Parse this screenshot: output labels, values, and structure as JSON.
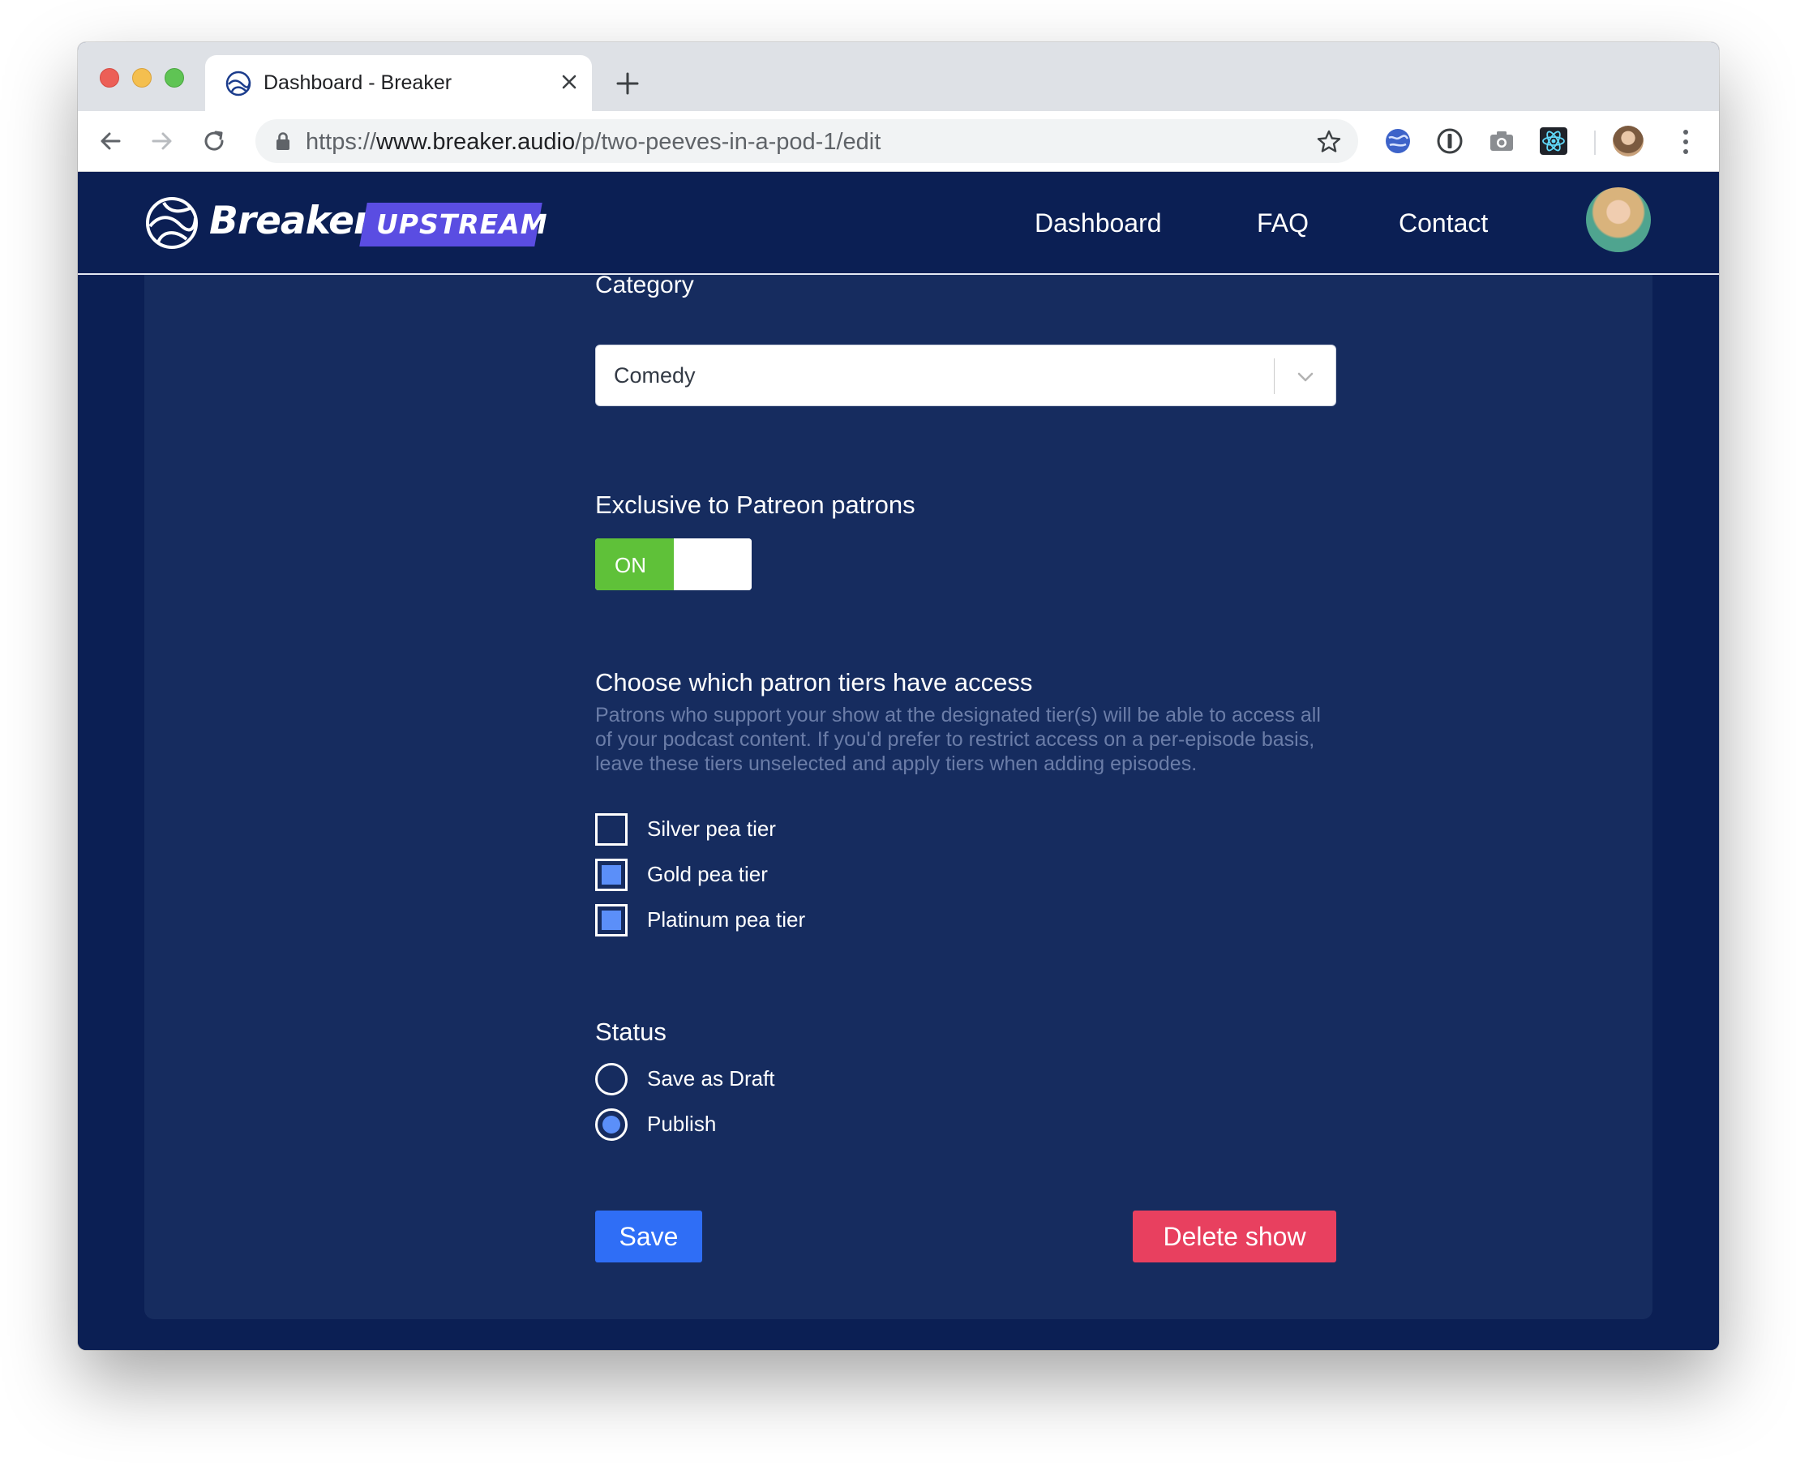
{
  "browser": {
    "tab_title": "Dashboard - Breaker",
    "url_scheme": "https://",
    "url_host": "www.breaker.audio",
    "url_path": "/p/two-peeves-in-a-pod-1/edit"
  },
  "nav": {
    "logo_text": "Breaker",
    "logo_badge": "UPSTREAM",
    "links": [
      "Dashboard",
      "FAQ",
      "Contact"
    ]
  },
  "form": {
    "category_label": "Category",
    "category_value": "Comedy",
    "exclusive_title": "Exclusive to Patreon patrons",
    "exclusive_toggle": "ON",
    "exclusive_enabled": true,
    "tiers_title": "Choose which patron tiers have access",
    "tiers_description": "Patrons who support your show at the designated tier(s) will be able to access all of your podcast content. If you'd prefer to restrict access on a per-episode basis, leave these tiers unselected and apply tiers when adding episodes.",
    "tiers": [
      {
        "label": "Silver pea tier",
        "checked": false
      },
      {
        "label": "Gold pea tier",
        "checked": true
      },
      {
        "label": "Platinum pea tier",
        "checked": true
      }
    ],
    "status_title": "Status",
    "status_options": [
      {
        "label": "Save as Draft",
        "selected": false
      },
      {
        "label": "Publish",
        "selected": true
      }
    ],
    "save_label": "Save",
    "delete_label": "Delete show"
  },
  "colors": {
    "page_bg": "#0b1f54",
    "card_bg": "#162c5f",
    "toggle_on": "#5fc139",
    "accent_blue": "#2f6ef6",
    "danger": "#e8405f",
    "checkbox_fill": "#5b8ff9"
  },
  "icons": [
    "back-icon",
    "forward-icon",
    "reload-icon",
    "lock-icon",
    "star-icon",
    "globe-extension-icon",
    "password-manager-icon",
    "camera-icon",
    "react-devtools-icon",
    "menu-icon",
    "chevron-down-icon",
    "breaker-logo-icon"
  ]
}
